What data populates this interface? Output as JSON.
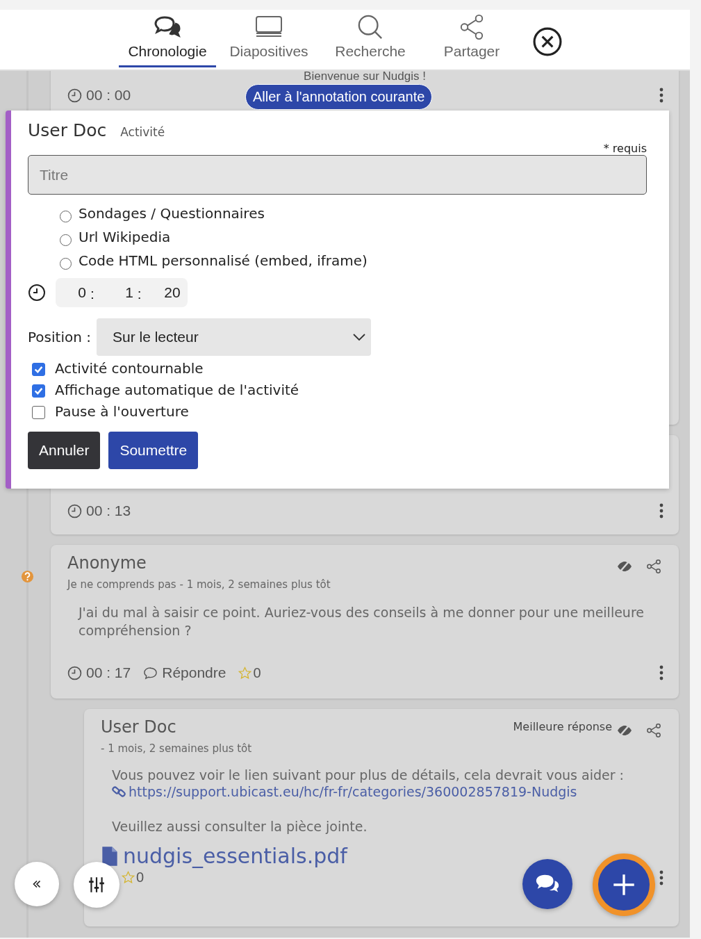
{
  "tabs": [
    {
      "label": "Chronologie",
      "selected": true,
      "kind": "chat"
    },
    {
      "label": "Diapositives",
      "selected": false,
      "kind": "slides"
    },
    {
      "label": "Recherche",
      "selected": false,
      "kind": "search"
    },
    {
      "label": "Partager",
      "selected": false,
      "kind": "share"
    }
  ],
  "jump_button": "Aller à l'annotation courante",
  "timeline": [
    {
      "kind": "annotation",
      "title": "Bienvenue sur Nudgis !",
      "time": "00 : 00"
    },
    {
      "kind": "annotation",
      "time": "00 : 13"
    },
    {
      "kind": "question",
      "author": "Anonyme",
      "meta": "Je ne comprends pas - 1 mois, 2 semaines plus tôt",
      "body": "J'ai du mal à saisir ce point. Auriez-vous des conseils à me donner pour une meilleure compréhension ?",
      "time": "00 : 17",
      "reply": "Répondre",
      "likes": "0",
      "replies": [
        {
          "author": "User Doc",
          "meta": "- 1 mois, 2 semaines plus tôt",
          "badge": "Meilleure réponse",
          "text": "Vous pouvez voir le lien suivant pour plus de détails, cela devrait vous aider :",
          "link": "https://support.ubicast.eu/hc/fr-fr/categories/360002857819-Nudgis",
          "note": "Veuillez aussi consulter la pièce jointe.",
          "attachment": "nudgis_essentials.pdf",
          "likes": "0"
        }
      ]
    }
  ],
  "form": {
    "title": "User Doc",
    "subtitle": "Activité",
    "required_note": "* requis",
    "title_field": {
      "placeholder": "Titre"
    },
    "options": [
      {
        "label": "Sondages / Questionnaires",
        "selected": false
      },
      {
        "label": "Url Wikipedia",
        "selected": false
      },
      {
        "label": "Code HTML personnalisé (embed, iframe)",
        "selected": false
      }
    ],
    "time": {
      "hours": "0",
      "minutes": "1",
      "seconds": "20",
      "separator": ":"
    },
    "position_label": "Position :",
    "position_value": "Sur le lecteur",
    "checkboxes": [
      {
        "label": "Activité contournable",
        "checked": true
      },
      {
        "label": "Affichage automatique de l'activité",
        "checked": true
      },
      {
        "label": "Pause à l'ouverture",
        "checked": false
      }
    ],
    "buttons": [
      {
        "label": "Annuler",
        "kind": "cancel"
      },
      {
        "label": "Soumettre",
        "kind": "submit"
      }
    ]
  }
}
